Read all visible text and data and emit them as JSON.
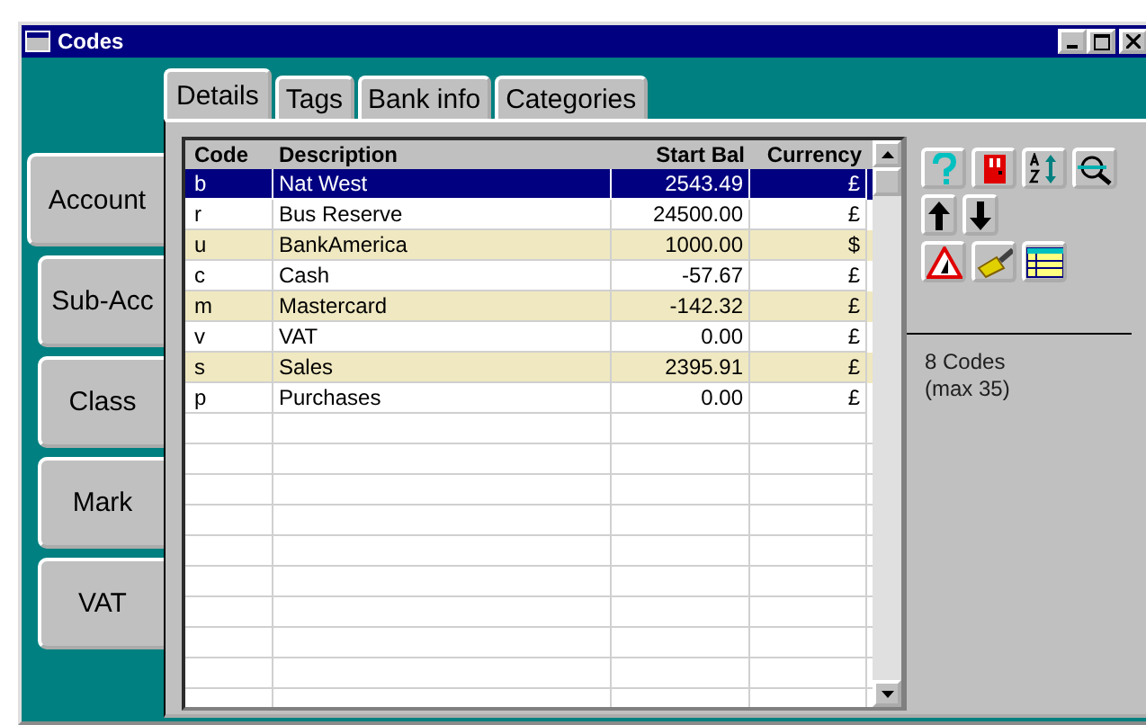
{
  "window": {
    "title": "Codes"
  },
  "tabs": [
    {
      "label": "Details",
      "selected": true
    },
    {
      "label": "Tags",
      "selected": false
    },
    {
      "label": "Bank info",
      "selected": false
    },
    {
      "label": "Categories",
      "selected": false
    }
  ],
  "side_tabs": [
    {
      "label": "Account",
      "selected": true
    },
    {
      "label": "Sub-Acc",
      "selected": false
    },
    {
      "label": "Class",
      "selected": false
    },
    {
      "label": "Mark",
      "selected": false
    },
    {
      "label": "VAT",
      "selected": false
    }
  ],
  "table": {
    "columns": [
      "Code",
      "Description",
      "Start Bal",
      "Currency"
    ],
    "rows": [
      {
        "cells": [
          "b",
          "Nat West",
          "2543.49",
          "£"
        ],
        "selected": true,
        "shaded": false
      },
      {
        "cells": [
          "r",
          "Bus Reserve",
          "24500.00",
          "£"
        ],
        "selected": false,
        "shaded": false
      },
      {
        "cells": [
          "u",
          "BankAmerica",
          "1000.00",
          "$"
        ],
        "selected": false,
        "shaded": true
      },
      {
        "cells": [
          "c",
          "Cash",
          "-57.67",
          "£"
        ],
        "selected": false,
        "shaded": false
      },
      {
        "cells": [
          "m",
          "Mastercard",
          "-142.32",
          "£"
        ],
        "selected": false,
        "shaded": true
      },
      {
        "cells": [
          "v",
          "VAT",
          "0.00",
          "£"
        ],
        "selected": false,
        "shaded": false
      },
      {
        "cells": [
          "s",
          "Sales",
          "2395.91",
          "£"
        ],
        "selected": false,
        "shaded": true
      },
      {
        "cells": [
          "p",
          "Purchases",
          "0.00",
          "£"
        ],
        "selected": false,
        "shaded": false
      }
    ]
  },
  "info": [
    "8 Codes",
    "(max 35)"
  ]
}
